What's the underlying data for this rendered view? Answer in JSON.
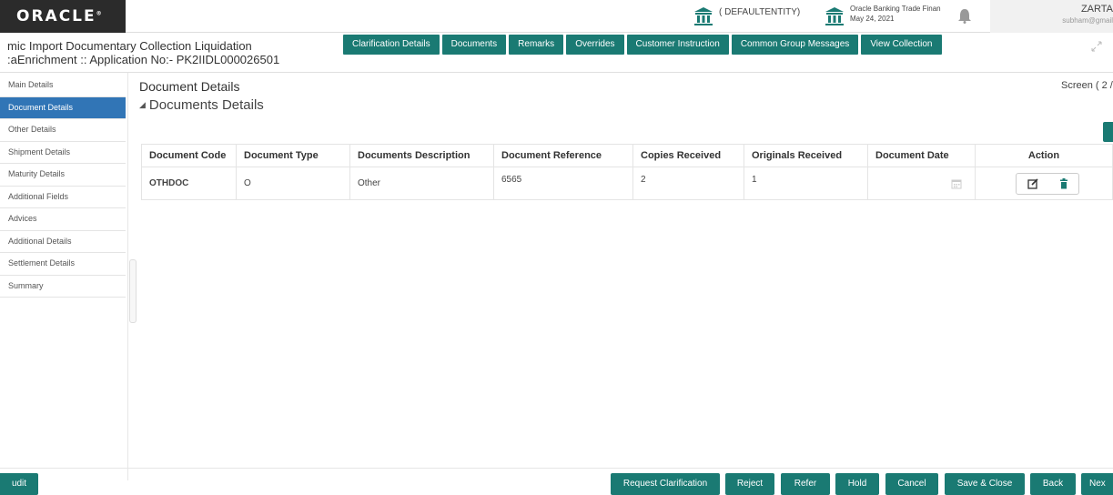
{
  "header": {
    "logo_text": "ORACLE",
    "entity": "( DEFAULTENTITY)",
    "branch_name": "Oracle Banking Trade Finan",
    "branch_date": "May 24, 2021",
    "user_name": "ZARTA",
    "user_email": "subham@gmail"
  },
  "title": {
    "line1": "mic Import Documentary Collection Liquidation",
    "line2": ":aEnrichment :: Application No:- PK2IIDL000026501"
  },
  "tabs": [
    "Clarification Details",
    "Documents",
    "Remarks",
    "Overrides",
    "Customer Instruction",
    "Common Group Messages",
    "View Collection"
  ],
  "sidebar": {
    "items": [
      {
        "label": "Main Details"
      },
      {
        "label": "Document Details"
      },
      {
        "label": "Other Details"
      },
      {
        "label": "Shipment Details"
      },
      {
        "label": "Maturity Details"
      },
      {
        "label": "Additional Fields"
      },
      {
        "label": "Advices"
      },
      {
        "label": "Additional Details"
      },
      {
        "label": "Settlement Details"
      },
      {
        "label": "Summary"
      }
    ],
    "active_index": 1
  },
  "main": {
    "section_title": "Document Details",
    "screen_label": "Screen ( 2 /",
    "subsection_title": "Documents Details",
    "table": {
      "headers": [
        "Document Code",
        "Document Type",
        "Documents Description",
        "Document Reference",
        "Copies Received",
        "Originals Received",
        "Document Date",
        "Action"
      ],
      "rows": [
        {
          "code": "OTHDOC",
          "type": "O",
          "description": "Other",
          "reference": "6565",
          "copies": "2",
          "originals": "1",
          "date": ""
        }
      ]
    }
  },
  "footer": {
    "left_button": "udit",
    "buttons": [
      "Request Clarification",
      "Reject",
      "Refer",
      "Hold",
      "Cancel",
      "Save & Close",
      "Back",
      "Nex"
    ]
  },
  "colors": {
    "accent": "#1a7a73",
    "active_sidebar": "#3175b6",
    "link": "#2a6ab3"
  }
}
